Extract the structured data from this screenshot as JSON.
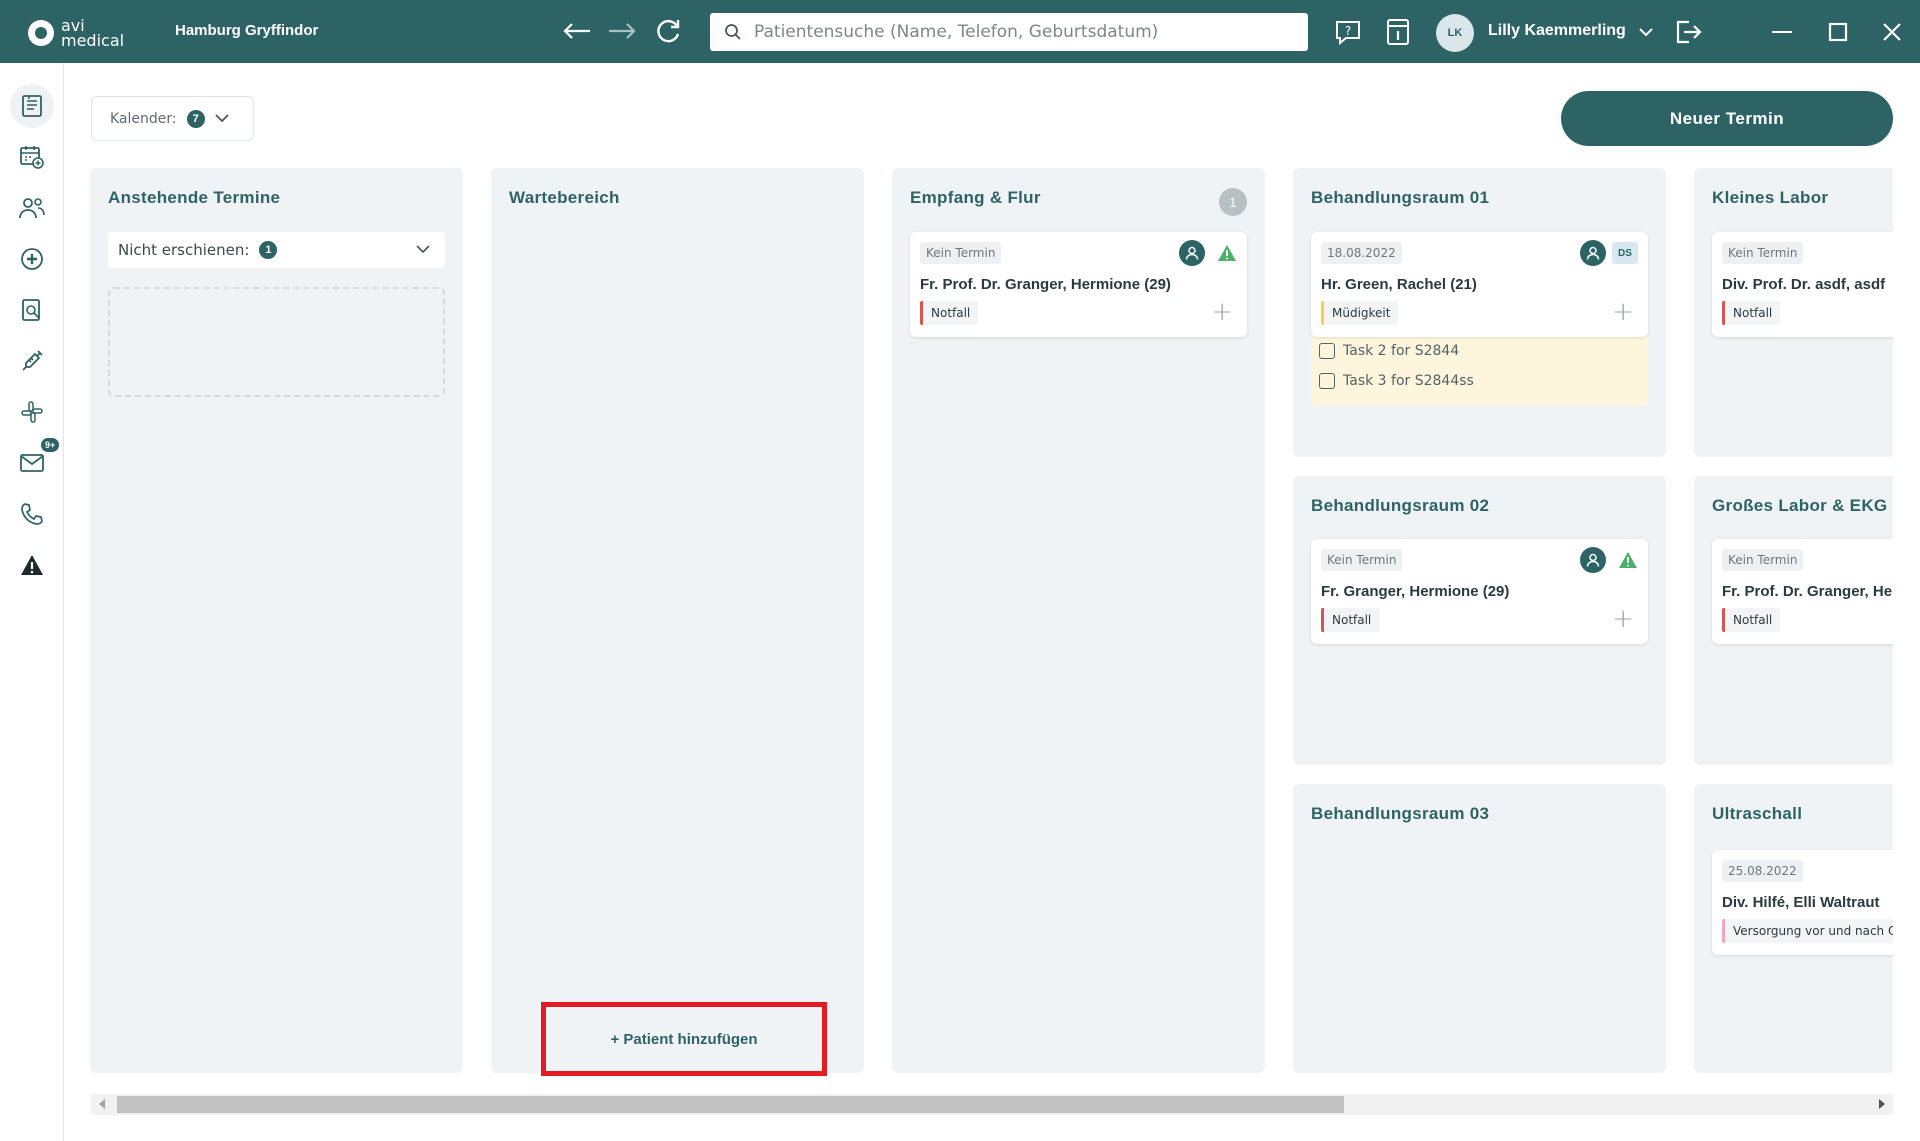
{
  "header": {
    "logo_line1": "avi",
    "logo_line2": "medical",
    "practice": "Hamburg Gryffindor",
    "search_placeholder": "Patientensuche (Name, Telefon, Geburtsdatum)",
    "user_initials": "LK",
    "user_name": "Lilly Kaemmerling"
  },
  "sidebar": {
    "mail_badge": "9+"
  },
  "toolbar": {
    "calendar_label": "Kalender:",
    "calendar_count": "7",
    "new_appointment": "Neuer Termin"
  },
  "columns": {
    "upcoming": {
      "title": "Anstehende Termine",
      "filter_label": "Nicht erschienen:",
      "filter_count": "1"
    },
    "waiting": {
      "title": "Wartebereich",
      "add_patient": "+ Patient hinzufügen"
    },
    "reception": {
      "title": "Empfang & Flur",
      "count": "1",
      "card": {
        "chip": "Kein Termin",
        "name": "Fr. Prof. Dr. Granger, Hermione (29)",
        "reason": "Notfall"
      }
    },
    "room01": {
      "title": "Behandlungsraum 01",
      "card": {
        "chip": "18.08.2022",
        "initials": "DS",
        "name": "Hr. Green, Rachel (21)",
        "reason": "Müdigkeit"
      },
      "tasks": [
        "Task 2 for S2844",
        "Task 3 for S2844ss"
      ]
    },
    "room02": {
      "title": "Behandlungsraum 02",
      "card": {
        "chip": "Kein Termin",
        "name": "Fr. Granger, Hermione (29)",
        "reason": "Notfall"
      }
    },
    "room03": {
      "title": "Behandlungsraum 03"
    },
    "small_lab": {
      "title": "Kleines Labor",
      "card": {
        "chip": "Kein Termin",
        "name": "Div. Prof. Dr. asdf, asdf",
        "reason": "Notfall"
      }
    },
    "big_lab": {
      "title": "Großes Labor & EKG",
      "card": {
        "chip": "Kein Termin",
        "name": "Fr. Prof. Dr. Granger, He",
        "reason": "Notfall"
      }
    },
    "ultrasound": {
      "title": "Ultraschall",
      "card": {
        "chip": "25.08.2022",
        "name": "Div. Hilfé, Elli Waltraut",
        "reason": "Versorgung vor und nach O"
      }
    }
  }
}
